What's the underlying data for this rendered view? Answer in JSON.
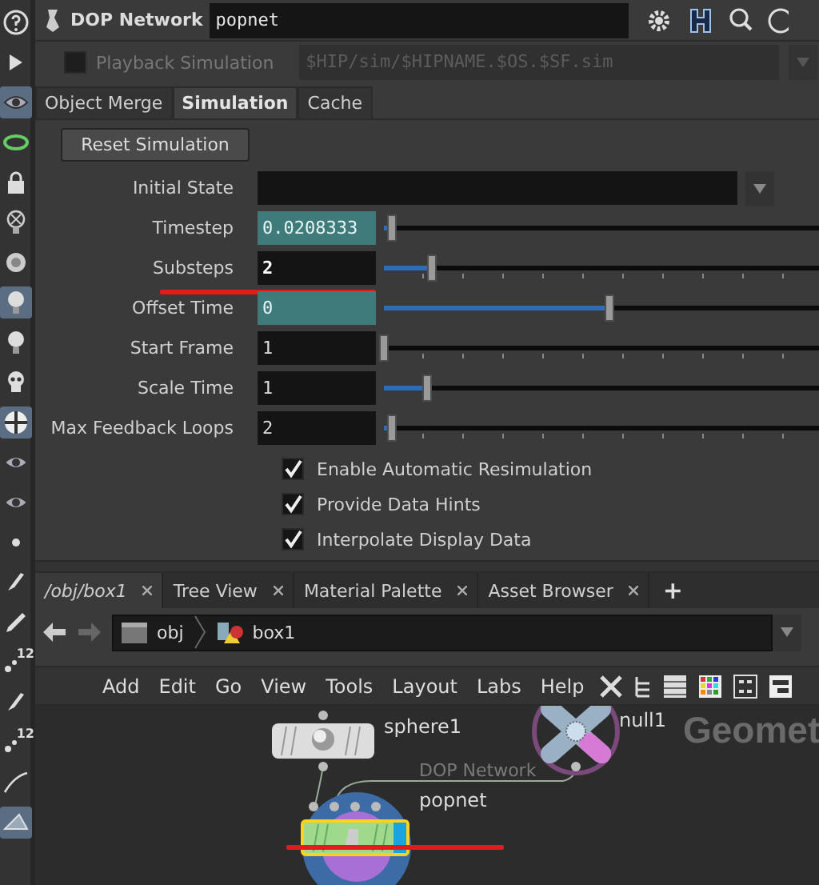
{
  "toolbar": [
    {
      "kind": "help",
      "selected": false
    },
    {
      "kind": "expand",
      "selected": false
    },
    {
      "kind": "eye",
      "selected": true
    },
    {
      "kind": "ring",
      "selected": false
    },
    {
      "kind": "lock",
      "selected": false
    },
    {
      "kind": "bulbx",
      "selected": false
    },
    {
      "kind": "knob",
      "selected": false
    },
    {
      "kind": "bulb",
      "selected": true
    },
    {
      "kind": "bulb",
      "selected": false
    },
    {
      "kind": "skull",
      "selected": false
    },
    {
      "kind": "ball",
      "selected": true
    },
    {
      "kind": "eye",
      "selected": false
    },
    {
      "kind": "eye",
      "selected": false
    },
    {
      "kind": "dot",
      "selected": false
    },
    {
      "kind": "brush",
      "selected": false
    },
    {
      "kind": "pen",
      "selected": false
    },
    {
      "kind": "points",
      "selected": false,
      "badge": "12"
    },
    {
      "kind": "brush",
      "selected": false
    },
    {
      "kind": "points",
      "selected": false,
      "badge": "12"
    },
    {
      "kind": "line",
      "selected": false
    },
    {
      "kind": "plane",
      "selected": true
    }
  ],
  "header": {
    "node_type": "DOP Network",
    "node_name": "popnet"
  },
  "playback": {
    "label": "Playback Simulation",
    "checked": false,
    "disabled": true,
    "value": "$HIP/sim/$HIPNAME.$OS.$SF.sim"
  },
  "tabs": [
    {
      "label": "Object Merge",
      "selected": false
    },
    {
      "label": "Simulation",
      "selected": true
    },
    {
      "label": "Cache",
      "selected": false
    }
  ],
  "reset_button": "Reset Simulation",
  "parameters": [
    {
      "kind": "menu",
      "label": "Initial State"
    },
    {
      "kind": "float",
      "label": "Timestep",
      "value": "0.0208333",
      "animated": true,
      "modified": false,
      "level": 0.02
    },
    {
      "kind": "int",
      "label": "Substeps",
      "value": "2",
      "animated": false,
      "modified": true,
      "highlight": true,
      "level": 0.11
    },
    {
      "kind": "float",
      "label": "Offset Time",
      "value": "0",
      "animated": true,
      "modified": false,
      "level": 0.52
    },
    {
      "kind": "int",
      "label": "Start Frame",
      "value": "1",
      "animated": false,
      "modified": false,
      "level": 0
    },
    {
      "kind": "float",
      "label": "Scale Time",
      "value": "1",
      "animated": false,
      "modified": false,
      "level": 0.1
    },
    {
      "kind": "int",
      "label": "Max Feedback Loops",
      "value": "2",
      "animated": false,
      "modified": false,
      "level": 0.02
    }
  ],
  "toggles": [
    {
      "label": "Enable Automatic Resimulation",
      "checked": true
    },
    {
      "label": "Provide Data Hints",
      "checked": true
    },
    {
      "label": "Interpolate Display Data",
      "checked": true
    }
  ],
  "pane_tabs": [
    {
      "label": "/obj/box1",
      "selected": true
    },
    {
      "label": "Tree View",
      "selected": false
    },
    {
      "label": "Material Palette",
      "selected": false
    },
    {
      "label": "Asset Browser",
      "selected": false
    }
  ],
  "add_tab": "+",
  "path": [
    {
      "kind": "obj",
      "label": "obj"
    },
    {
      "kind": "geo",
      "label": "box1"
    }
  ],
  "menu": [
    "Add",
    "Edit",
    "Go",
    "View",
    "Tools",
    "Layout",
    "Labs",
    "Help"
  ],
  "network": {
    "context_label": "Geomet",
    "nodes": [
      {
        "kind": "sphere",
        "name": "sphere1"
      },
      {
        "kind": "null",
        "name": "null1"
      },
      {
        "kind": "dopnet",
        "type_label": "DOP Network",
        "name": "popnet",
        "highlight": true
      }
    ]
  }
}
